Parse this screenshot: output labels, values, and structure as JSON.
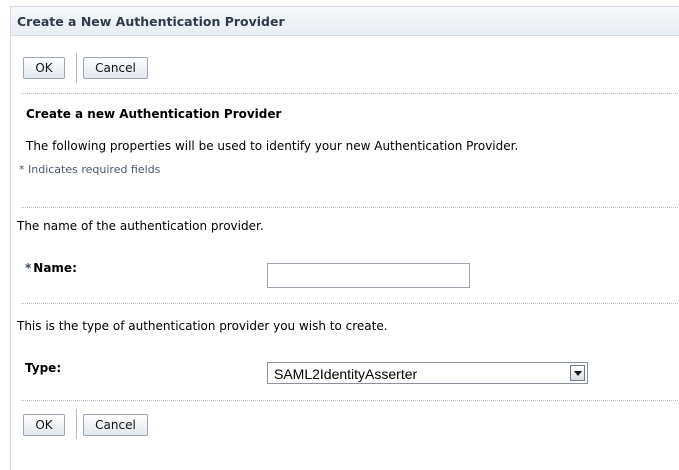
{
  "header": {
    "title": "Create a New Authentication Provider"
  },
  "top_actions": {
    "ok_label": "OK",
    "cancel_label": "Cancel"
  },
  "intro": {
    "heading": "Create a new Authentication Provider",
    "description": "The following properties will be used to identify your new Authentication Provider.",
    "required_star": "*",
    "required_note": "Indicates required fields"
  },
  "name_section": {
    "description": "The name of the authentication provider.",
    "required_star": "*",
    "label": "Name:",
    "value": ""
  },
  "type_section": {
    "description": "This is the type of authentication provider you wish to create.",
    "label": "Type:",
    "selected": "SAML2IdentityAsserter"
  },
  "bottom_actions": {
    "ok_label": "OK",
    "cancel_label": "Cancel"
  }
}
